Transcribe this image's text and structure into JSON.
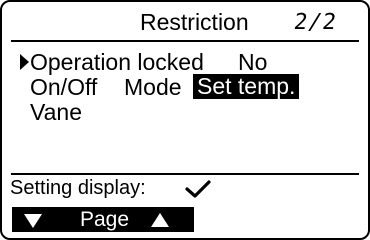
{
  "header": {
    "title": "Restriction",
    "page_indicator": "2/2"
  },
  "menu": {
    "operation_locked": {
      "label": "Operation locked",
      "value": "No",
      "selected": true
    },
    "items_row2": [
      "On/Off",
      "Mode",
      "Set temp."
    ],
    "highlighted_item": "Set temp.",
    "item_row3": "Vane"
  },
  "footer": {
    "setting_display_label": "Setting display:",
    "setting_display_icon": "check-icon",
    "page_bar": {
      "label": "Page",
      "left_icon": "down-arrow-icon",
      "right_icon": "up-arrow-icon"
    }
  },
  "colors": {
    "background": "#ffffff",
    "foreground": "#000000",
    "highlight_bg": "#000000",
    "highlight_fg": "#ffffff"
  }
}
